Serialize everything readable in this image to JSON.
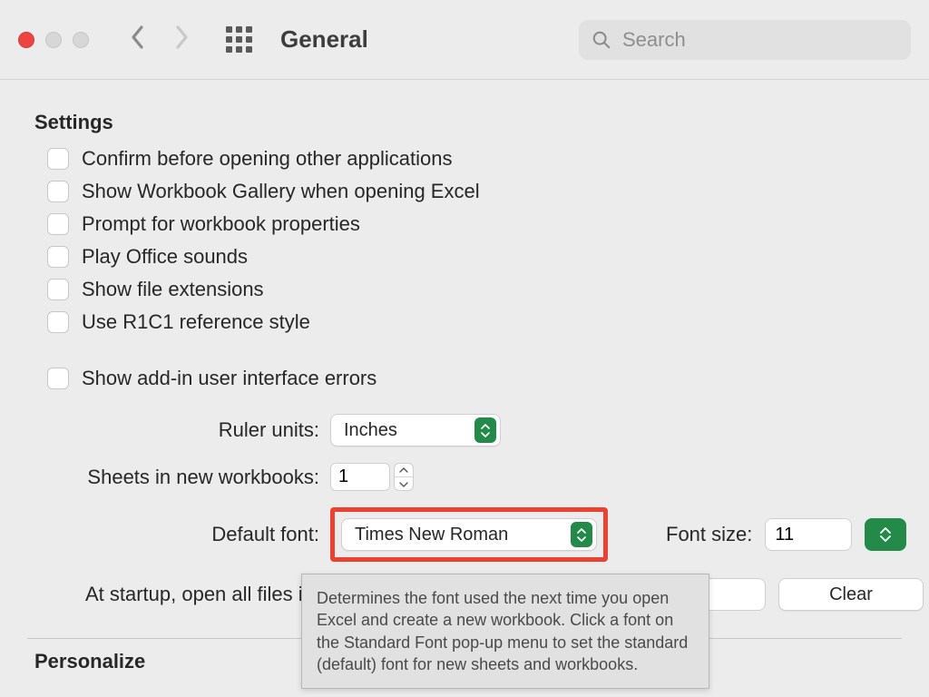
{
  "toolbar": {
    "title": "General",
    "search_placeholder": "Search"
  },
  "sections": {
    "settings": "Settings",
    "personalize": "Personalize"
  },
  "options": [
    "Confirm before opening other applications",
    "Show Workbook Gallery when opening Excel",
    "Prompt for workbook properties",
    "Play Office sounds",
    "Show file extensions",
    "Use R1C1 reference style"
  ],
  "addin_errors": "Show add-in user interface errors",
  "form": {
    "ruler_label": "Ruler units:",
    "ruler_value": "Inches",
    "sheets_label": "Sheets in new workbooks:",
    "sheets_value": "1",
    "font_label": "Default font:",
    "font_value": "Times New Roman",
    "fontsize_label": "Font size:",
    "fontsize_value": "11",
    "startup_label": "At startup, open all files in:",
    "startup_value": "",
    "clear_label": "Clear"
  },
  "tooltip": "Determines the font used the next time you open Excel and create a new workbook. Click a font on the Standard Font pop-up menu to set the standard (default) font for new sheets and workbooks."
}
